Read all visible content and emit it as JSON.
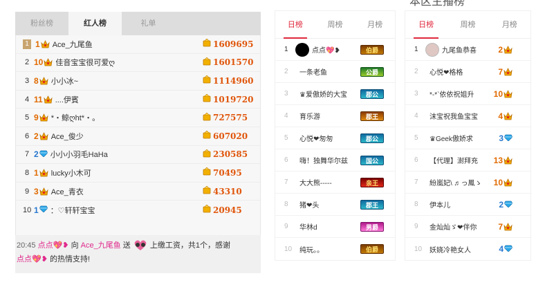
{
  "panel1": {
    "tabs": [
      "粉丝榜",
      "红人榜",
      "礼单"
    ],
    "rows": [
      {
        "rank": "1",
        "level": "1",
        "nick": "Ace_九尾鱼",
        "score": "1609695",
        "gem": "crown"
      },
      {
        "rank": "2",
        "level": "10",
        "nick": "佳音宝宝很可爱ღ",
        "score": "1601570",
        "gem": "crown"
      },
      {
        "rank": "3",
        "level": "8",
        "nick": "小小冰~",
        "score": "1114960",
        "gem": "crown"
      },
      {
        "rank": "4",
        "level": "11",
        "nick": "....伊賓",
        "score": "1019720",
        "gem": "crown"
      },
      {
        "rank": "5",
        "level": "9",
        "nick": "*・鲸ღht*・。",
        "score": "727575",
        "gem": "crown"
      },
      {
        "rank": "6",
        "level": "2",
        "nick": "Ace_俊少",
        "score": "607020",
        "gem": "crown"
      },
      {
        "rank": "7",
        "level": "2",
        "nick": "小小小羽毛HaHa",
        "score": "230585",
        "gem": "diamond"
      },
      {
        "rank": "8",
        "level": "1",
        "nick": "lucky小木可",
        "score": "70495",
        "gem": "crown"
      },
      {
        "rank": "9",
        "level": "3",
        "nick": "Ace_青衣",
        "score": "43310",
        "gem": "crown"
      },
      {
        "rank": "10",
        "level": "1",
        "nick": "：♡轩轩宝宝",
        "score": "20945",
        "gem": "diamond"
      }
    ],
    "feed": {
      "time": "20:45",
      "sender": "点点💖❥",
      "to_word": "向",
      "receiver": "Ace_九尾鱼",
      "send_word": "送",
      "message": "上缴工资，共1个，感谢",
      "sender2": "点点💖❥",
      "tail": "的热情支持!"
    }
  },
  "panel2": {
    "tabs": [
      "日榜",
      "周榜",
      "月榜"
    ],
    "rows": [
      {
        "rank": "1",
        "name": "点点💖❥",
        "badge": "伯爵",
        "badge_style": "gold",
        "avatar": "black"
      },
      {
        "rank": "2",
        "name": "一条老鱼",
        "badge": "公爵",
        "badge_style": "green",
        "avatar": ""
      },
      {
        "rank": "3",
        "name": "♛爱傲娇的大宝",
        "badge": "郡公",
        "badge_style": "cyan",
        "avatar": ""
      },
      {
        "rank": "4",
        "name": "育乐游",
        "badge": "郡王",
        "badge_style": "orange",
        "avatar": ""
      },
      {
        "rank": "5",
        "name": "心悦❤匆匆",
        "badge": "郡公",
        "badge_style": "cyan",
        "avatar": ""
      },
      {
        "rank": "6",
        "name": "嗨！独舞华尔兹",
        "badge": "国公",
        "badge_style": "cyan",
        "avatar": ""
      },
      {
        "rank": "7",
        "name": "大大熊-----",
        "badge": "亲王",
        "badge_style": "red",
        "avatar": ""
      },
      {
        "rank": "8",
        "name": "猪❤头",
        "badge": "郡王",
        "badge_style": "cyan",
        "avatar": ""
      },
      {
        "rank": "9",
        "name": "华林d",
        "badge": "男爵",
        "badge_style": "pink",
        "avatar": ""
      },
      {
        "rank": "10",
        "name": "纯玩。。",
        "badge": "伯爵",
        "badge_style": "gold",
        "avatar": ""
      }
    ]
  },
  "panel3": {
    "title": "本区主播榜",
    "tabs": [
      "日榜",
      "周榜",
      "月榜"
    ],
    "rows": [
      {
        "rank": "1",
        "name": "九尾鱼恭喜",
        "level": "2",
        "gem": "crown",
        "avatar": "girl"
      },
      {
        "rank": "2",
        "name": "心悦❤格格",
        "level": "7",
        "gem": "crown",
        "avatar": ""
      },
      {
        "rank": "3",
        "name": "*-*`依依祝姐升",
        "level": "10",
        "gem": "crown",
        "avatar": ""
      },
      {
        "rank": "4",
        "name": "沫宝祝我鱼宝宝",
        "level": "4",
        "gem": "crown",
        "avatar": ""
      },
      {
        "rank": "5",
        "name": "♛Geek傲娇求",
        "level": "3",
        "gem": "diamond",
        "avatar": ""
      },
      {
        "rank": "6",
        "name": "【代理】澍拜充",
        "level": "13",
        "gem": "crown",
        "avatar": ""
      },
      {
        "rank": "7",
        "name": "紛嵐妃\\ ♬っ鳳ゝ",
        "level": "10",
        "gem": "crown",
        "avatar": ""
      },
      {
        "rank": "8",
        "name": "伊本儿",
        "level": "2",
        "gem": "diamond",
        "avatar": ""
      },
      {
        "rank": "9",
        "name": "金灿灿ゞ❤伴你",
        "level": "7",
        "gem": "crown",
        "avatar": ""
      },
      {
        "rank": "10",
        "name": "妖娆冷艳女人",
        "level": "4",
        "gem": "diamond",
        "avatar": ""
      }
    ]
  }
}
